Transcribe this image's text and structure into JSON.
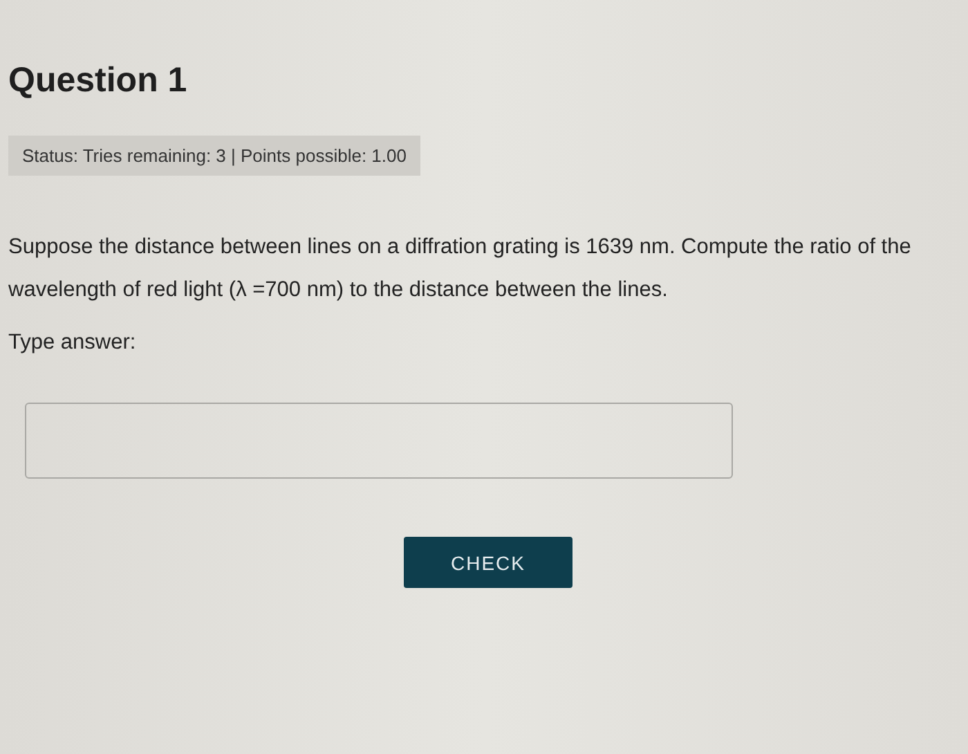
{
  "question": {
    "title": "Question 1",
    "status": "Status: Tries remaining: 3 | Points possible: 1.00",
    "prompt": "Suppose the distance between lines on a diffration grating is 1639 nm. Compute the ratio of the wavelength of red light (λ =700 nm) to the distance between the lines.",
    "answer_label": "Type answer:",
    "check_button": "CHECK"
  }
}
